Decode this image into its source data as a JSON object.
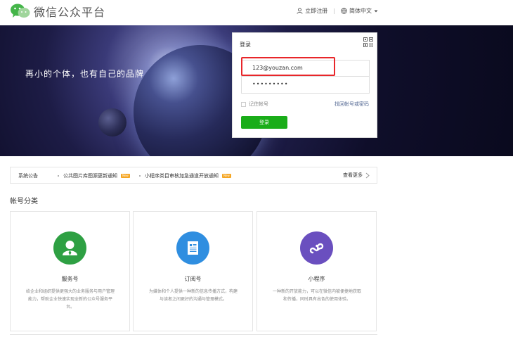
{
  "header": {
    "logo_text": "微信公众平台",
    "register_label": "立即注册",
    "language_label": "简体中文"
  },
  "banner": {
    "slogan": "再小的个体，也有自己的品牌"
  },
  "login": {
    "title": "登录",
    "account_value": "123@youzan.com",
    "password_value": "•••••••••",
    "remember_label": "记住帐号",
    "forgot_label": "找回帐号或密码",
    "submit_label": "登录"
  },
  "notice": {
    "title": "系统公告",
    "items": [
      {
        "text": "公共图片库图源更新通知",
        "tag": "New"
      },
      {
        "text": "小程序类目审核加急通道开放通知",
        "tag": "New"
      }
    ],
    "more_label": "查看更多"
  },
  "section": {
    "title": "帐号分类",
    "cards": [
      {
        "name": "服务号",
        "desc": "给企业和组织提供更强大的业务服务与用户管理能力，帮助企业快速实现全新的公众号服务平台。",
        "color": "#2ea043",
        "icon": "person-icon"
      },
      {
        "name": "订阅号",
        "desc": "为媒体和个人提供一种新的信息传播方式，构建与读者之间更好的沟通与管理模式。",
        "color": "#2f8ee0",
        "icon": "document-icon"
      },
      {
        "name": "小程序",
        "desc": "一种新的开放能力，可以在微信内被便捷地获取和传播，同时具有出色的使用体验。",
        "color": "#6a4fbf",
        "icon": "mini-program-icon"
      }
    ]
  },
  "colors": {
    "accent_green": "#1aad19",
    "highlight_red": "#e8262a",
    "link_blue": "#576b95"
  }
}
